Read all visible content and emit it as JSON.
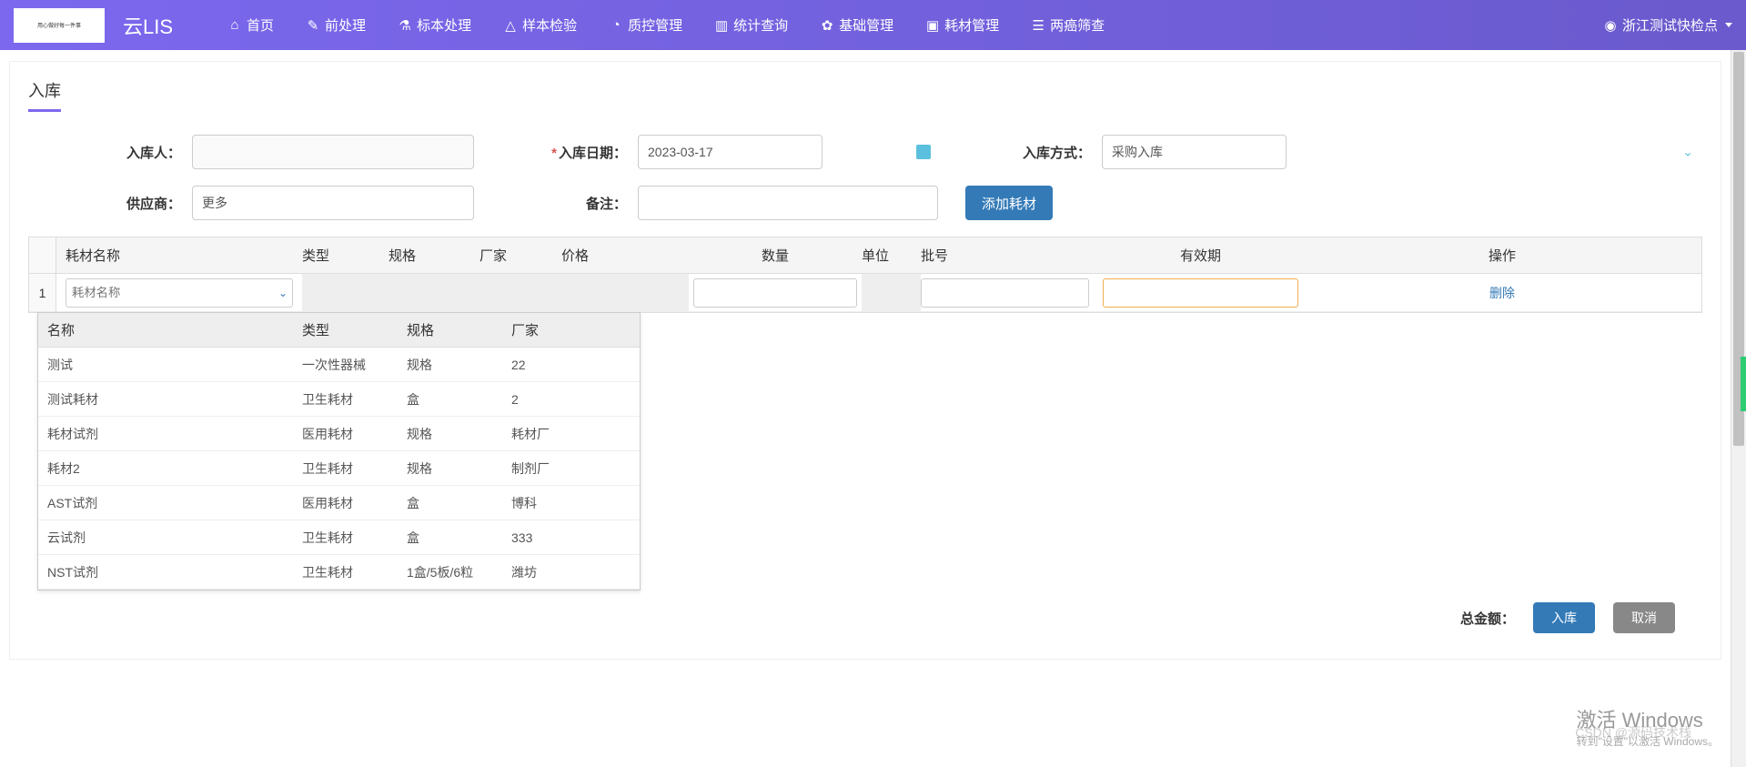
{
  "header": {
    "logo_text": "用心做好每一件事",
    "app_name": "云LIS",
    "nav": [
      "首页",
      "前处理",
      "标本处理",
      "样本检验",
      "质控管理",
      "统计查询",
      "基础管理",
      "耗材管理",
      "两癌筛查"
    ],
    "user": "浙江测试快检点"
  },
  "page": {
    "title": "入库",
    "form": {
      "labels": {
        "operator": "入库人：",
        "date": "入库日期：",
        "method": "入库方式：",
        "supplier": "供应商：",
        "remark": "备注："
      },
      "values": {
        "operator": "",
        "date": "2023-03-17",
        "method": "采购入库",
        "supplier": "更多",
        "remark": ""
      },
      "add_button": "添加耗材"
    },
    "grid": {
      "headers": [
        "耗材名称",
        "类型",
        "规格",
        "厂家",
        "价格",
        "数量",
        "单位",
        "批号",
        "有效期",
        "操作"
      ],
      "row_index": "1",
      "combo_placeholder": "耗材名称",
      "delete_label": "删除"
    },
    "dropdown": {
      "headers": [
        "名称",
        "类型",
        "规格",
        "厂家"
      ],
      "rows": [
        {
          "name": "测试",
          "type": "一次性器械",
          "spec": "规格",
          "vendor": "22"
        },
        {
          "name": "测试耗材",
          "type": "卫生耗材",
          "spec": "盒",
          "vendor": "2"
        },
        {
          "name": "耗材试剂",
          "type": "医用耗材",
          "spec": "规格",
          "vendor": "耗材厂"
        },
        {
          "name": "耗材2",
          "type": "卫生耗材",
          "spec": "规格",
          "vendor": "制剂厂"
        },
        {
          "name": "AST试剂",
          "type": "医用耗材",
          "spec": "盒",
          "vendor": "博科"
        },
        {
          "name": "云试剂",
          "type": "卫生耗材",
          "spec": "盒",
          "vendor": "333"
        },
        {
          "name": "NST试剂",
          "type": "卫生耗材",
          "spec": "1盒/5板/6粒",
          "vendor": "潍坊"
        }
      ]
    },
    "footer": {
      "total_label": "总金额：",
      "save": "入库",
      "cancel": "取消"
    }
  },
  "watermark": {
    "line1": "激活 Windows",
    "line2": "转到\"设置\"以激活 Windows。",
    "csdn": "CSDN @源码技术栈"
  }
}
